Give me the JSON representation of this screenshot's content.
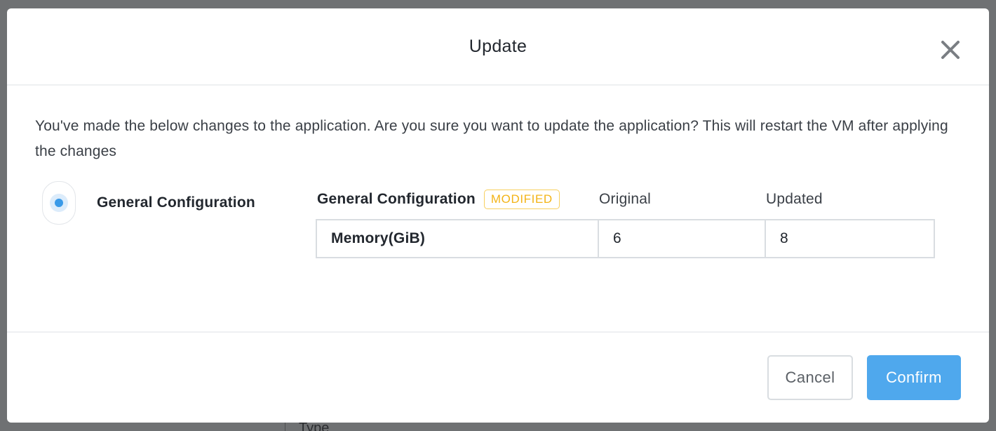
{
  "background": {
    "peek_text": "Type"
  },
  "modal": {
    "title": "Update",
    "close_icon": "close-icon",
    "description": "You've made the below changes to the application. Are you sure you want to update the application? This will restart the VM after applying the changes",
    "sections": [
      {
        "label": "General Configuration",
        "selected": true
      }
    ],
    "changes": {
      "title": "General Configuration",
      "badge": "MODIFIED",
      "columns": {
        "original": "Original",
        "updated": "Updated"
      },
      "rows": [
        {
          "field": "Memory(GiB)",
          "original": "6",
          "updated": "8"
        }
      ]
    },
    "footer": {
      "cancel_label": "Cancel",
      "confirm_label": "Confirm"
    }
  },
  "colors": {
    "accent": "#4fa8ed",
    "badge": "#f3b417",
    "radio": "#3a9ae8"
  }
}
